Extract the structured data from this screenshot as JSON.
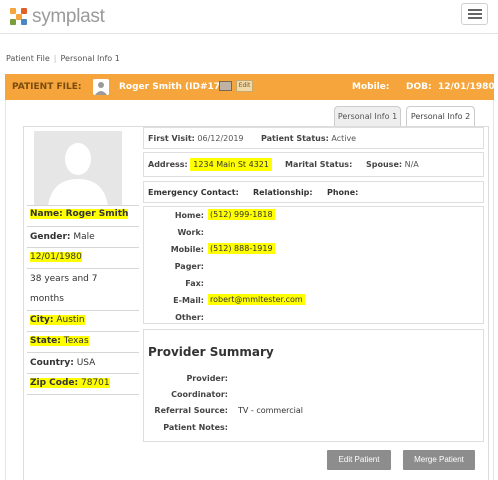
{
  "app": {
    "logo_text": "symplast",
    "brand_colors": [
      "#f5a53c",
      "#e0602a",
      "#7a9c3a",
      "#4b86c4"
    ]
  },
  "topbar": {
    "menu_icon": "hamburger-menu-icon"
  },
  "breadcrumb": {
    "items": [
      "Patient File",
      "Personal Info 1"
    ]
  },
  "banner": {
    "label": "PATIENT FILE:",
    "patient_name": "Roger Smith (ID#17)",
    "edit_tag": "Edit",
    "mobile_label": "Mobile:",
    "dob_label": "DOB:",
    "dob_value": "12/01/1980",
    "accent_color": "#f5a53c"
  },
  "tabs": [
    {
      "label": "Personal Info 1",
      "active": false
    },
    {
      "label": "Personal Info 2",
      "active": true
    }
  ],
  "profile": {
    "name_label": "Name:",
    "name_value": "Roger Smith",
    "gender_label": "Gender:",
    "gender_value": "Male",
    "dob": "12/01/1980",
    "age_line1": "38 years and 7",
    "age_line2": "months",
    "city_label": "City:",
    "city_value": "Austin",
    "state_label": "State:",
    "state_value": "Texas",
    "country_label": "Country:",
    "country_value": "USA",
    "zip_label": "Zip Code:",
    "zip_value": "78701"
  },
  "visit": {
    "first_visit_label": "First Visit:",
    "first_visit_value": "06/12/2019",
    "status_label": "Patient Status:",
    "status_value": "Active"
  },
  "address": {
    "address_label": "Address:",
    "address_value": "1234 Main St 4321",
    "marital_label": "Marital Status:",
    "marital_value": "",
    "spouse_label": "Spouse:",
    "spouse_value": "N/A"
  },
  "emergency": {
    "contact_label": "Emergency Contact:",
    "relationship_label": "Relationship:",
    "phone_label": "Phone:"
  },
  "contact": {
    "home_label": "Home:",
    "home_value": "(512) 999-1818",
    "work_label": "Work:",
    "work_value": "",
    "mobile_label": "Mobile:",
    "mobile_value": "(512) 888-1919",
    "pager_label": "Pager:",
    "fax_label": "Fax:",
    "email_label": "E-Mail:",
    "email_value": "robert@mmltester.com",
    "other_label": "Other:"
  },
  "provider": {
    "title": "Provider Summary",
    "provider_label": "Provider:",
    "coordinator_label": "Coordinator:",
    "referral_label": "Referral Source:",
    "referral_value": "TV - commercial",
    "notes_label": "Patient Notes:"
  },
  "actions": {
    "edit_label": "Edit Patient",
    "merge_label": "Merge Patient"
  }
}
